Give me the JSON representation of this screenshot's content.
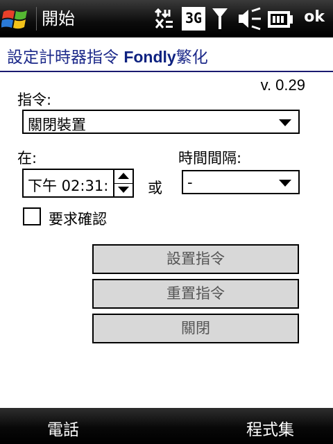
{
  "statusbar": {
    "start_label": "開始",
    "network_label": "3G",
    "ok_label": "ok"
  },
  "app": {
    "title_prefix": "設定計時器指令 ",
    "title_brand": "Fondly",
    "title_suffix": "繁化"
  },
  "form": {
    "version": "v. 0.29",
    "command_label": "指令:",
    "command_value": "關閉裝置",
    "at_label": "在:",
    "time_value": "下午 02:31:",
    "or_label": "或",
    "interval_label": "時間間隔:",
    "interval_value": "-",
    "confirm_label": "要求確認",
    "confirm_checked": false
  },
  "buttons": {
    "set": "設置指令",
    "reset": "重置指令",
    "close": "關閉"
  },
  "softkeys": {
    "left": "電話",
    "right": "程式集"
  }
}
